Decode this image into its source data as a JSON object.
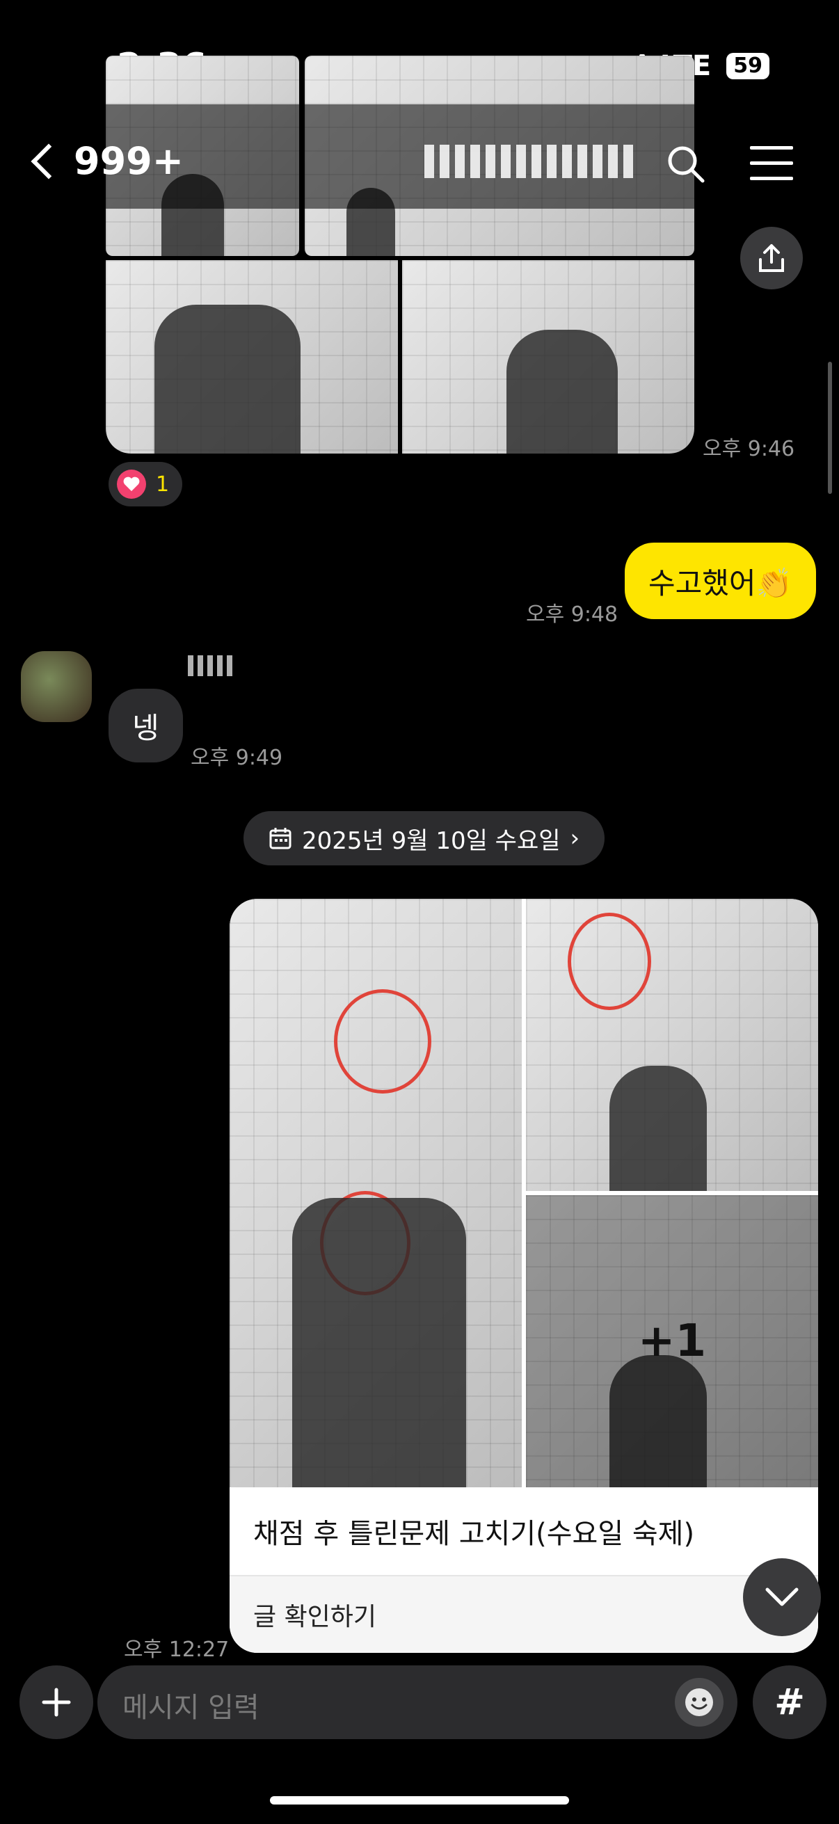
{
  "status_bar": {
    "time": "2:36",
    "network": "LTE",
    "battery": "59"
  },
  "header": {
    "back_label": "999+"
  },
  "messages": {
    "photo_time": "오후 9:46",
    "reaction_count": "1",
    "sent_text": "수고했어👏",
    "sent_time": "오후 9:48",
    "reply_text": "넹",
    "reply_time": "오후 9:49"
  },
  "date_divider": "2025년 9월 10일 수요일",
  "post": {
    "more_count": "+1",
    "title": "채점 후 틀린문제 고치기(수요일 숙제)",
    "action": "글 확인하기",
    "time": "오후 12:27"
  },
  "input": {
    "placeholder": "메시지 입력"
  },
  "colors": {
    "sent_bubble": "#fee500",
    "received_bubble": "#2c2c2e",
    "background": "#000000"
  }
}
